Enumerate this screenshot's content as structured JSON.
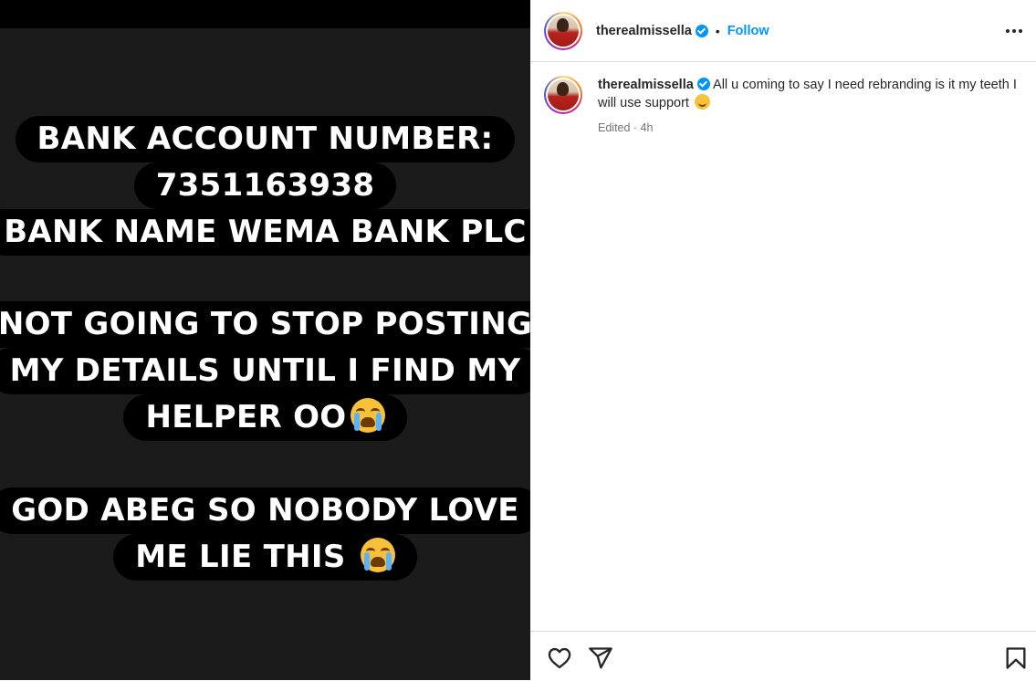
{
  "story": {
    "blocks": [
      {
        "lines": [
          {
            "text": "BANK ACCOUNT NUMBER:"
          },
          {
            "text": "7351163938"
          },
          {
            "text": "BANK NAME WEMA BANK PLC"
          }
        ]
      },
      {
        "lines": [
          {
            "text": "NOT GOING TO STOP POSTING"
          },
          {
            "text": "MY DETAILS UNTIL I FIND MY"
          },
          {
            "text": "HELPER OO",
            "emoji": "loudly-crying-face"
          }
        ]
      },
      {
        "lines": [
          {
            "text": "GOD ABEG SO NOBODY LOVE"
          },
          {
            "text": "ME LIE THIS ",
            "emoji": "loudly-crying-face"
          }
        ]
      }
    ]
  },
  "header": {
    "username": "therealmissella",
    "separator": "•",
    "follow_label": "Follow"
  },
  "caption": {
    "username": "therealmissella",
    "text": "All u coming to say I need rebranding is it my teeth I will use support",
    "emoji": "smiling-face",
    "meta": "Edited · 4h"
  },
  "icons": {
    "verified": "verified-badge-icon",
    "more": "more-options-icon",
    "like": "heart-icon",
    "share": "paper-plane-icon",
    "save": "bookmark-icon"
  },
  "colors": {
    "accent": "#0095f6",
    "text": "#262626",
    "muted": "#737373",
    "story_bg": "#1b1b1b",
    "pill_bg": "#000000"
  }
}
